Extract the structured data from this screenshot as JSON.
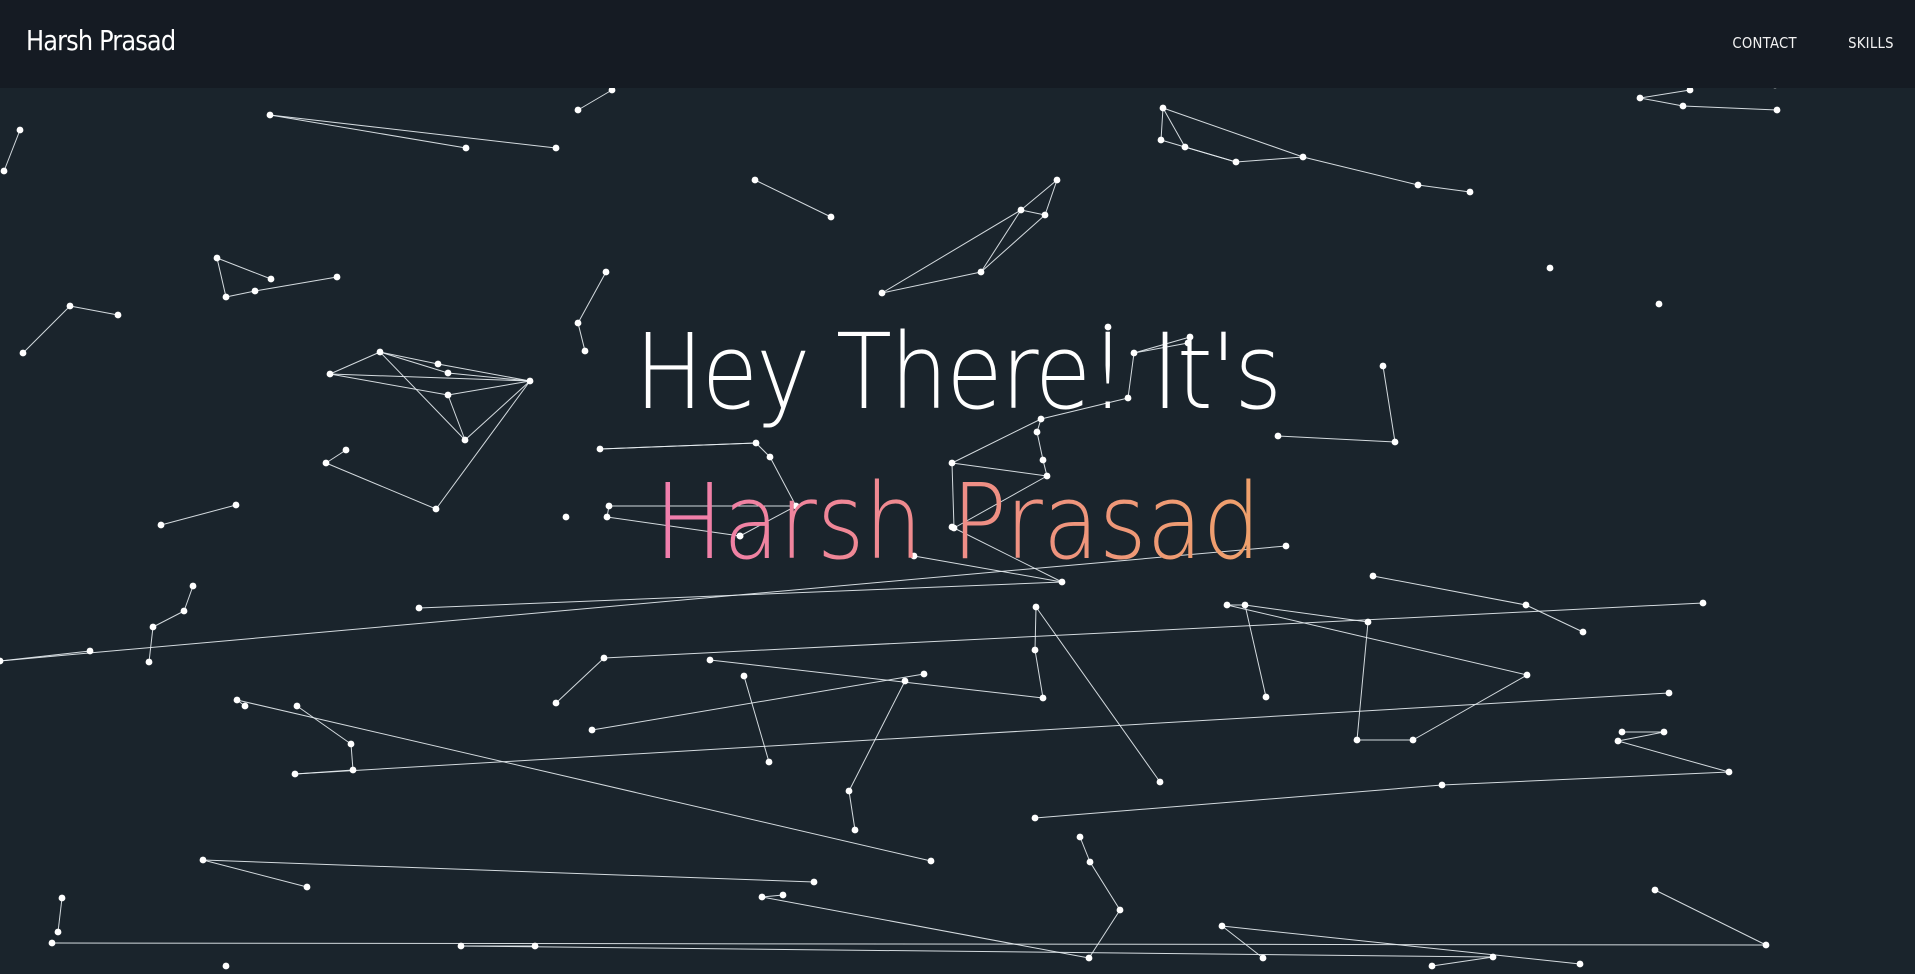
{
  "navbar": {
    "brand": "Harsh Prasad",
    "links": [
      {
        "label": "CONTACT"
      },
      {
        "label": "SKILLS"
      }
    ]
  },
  "hero": {
    "greeting": "Hey There! It's",
    "name": "Harsh Prasad",
    "name_gradient": [
      "#f07dae",
      "#efa16b"
    ]
  },
  "colors": {
    "background": "#1a242c",
    "navbar": "#151b23",
    "particles": "#ffffff"
  }
}
